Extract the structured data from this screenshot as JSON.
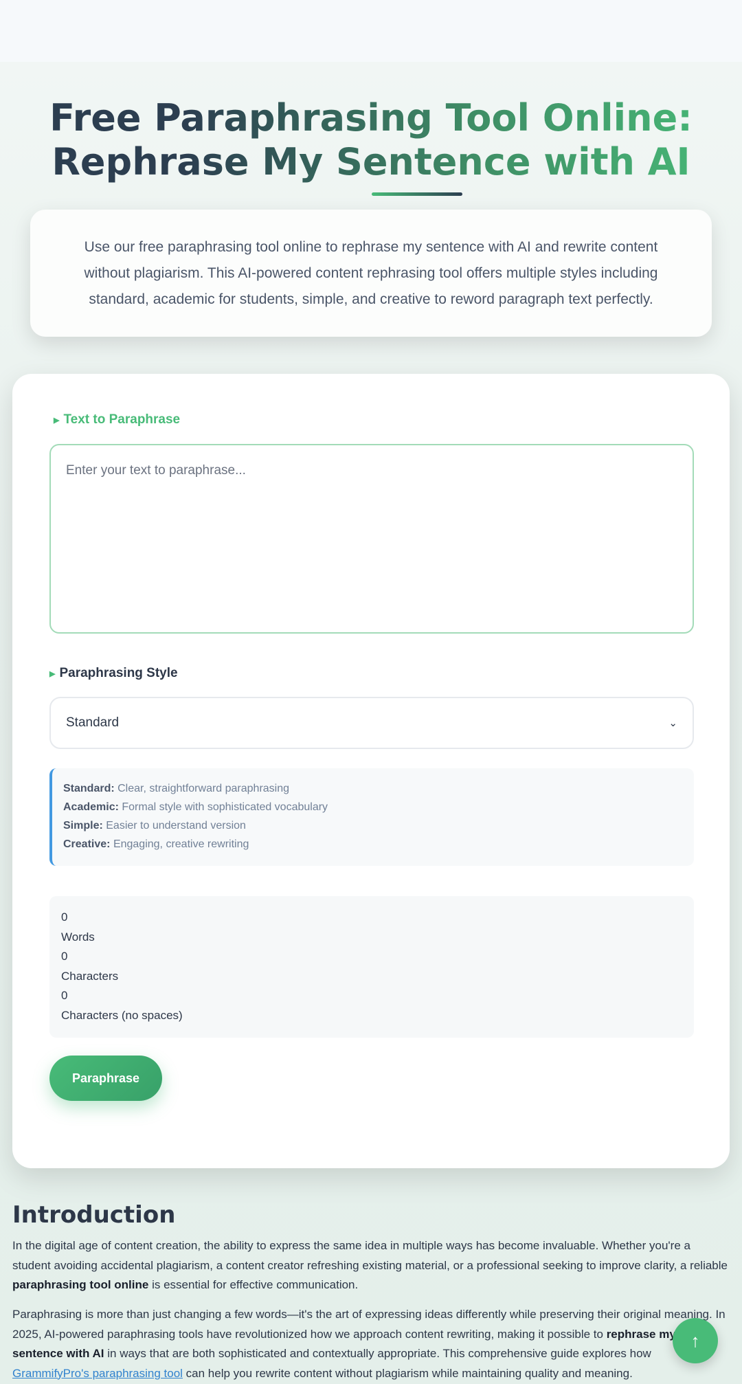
{
  "hero": {
    "title": "Free Paraphrasing Tool Online: Rephrase My Sentence with AI",
    "description": "Use our free paraphrasing tool online to rephrase my sentence with AI and rewrite content without plagiarism. This AI-powered content rephrasing tool offers multiple styles including standard, academic for students, simple, and creative to reword paragraph text perfectly."
  },
  "tool": {
    "text_label": "Text to Paraphrase",
    "textarea_placeholder": "Enter your text to paraphrase...",
    "style_label": "Paraphrasing Style",
    "style_selected": "Standard",
    "styles_info": [
      {
        "name": "Standard:",
        "desc": "Clear, straightforward paraphrasing"
      },
      {
        "name": "Academic:",
        "desc": "Formal style with sophisticated vocabulary"
      },
      {
        "name": "Simple:",
        "desc": "Easier to understand version"
      },
      {
        "name": "Creative:",
        "desc": "Engaging, creative rewriting"
      }
    ],
    "stats": {
      "words_count": "0",
      "words_label": "Words",
      "chars_count": "0",
      "chars_label": "Characters",
      "chars_nospace_count": "0",
      "chars_nospace_label": "Characters (no spaces)"
    },
    "button_label": "Paraphrase"
  },
  "introduction": {
    "heading": "Introduction",
    "p1_a": "In the digital age of content creation, the ability to express the same idea in multiple ways has become invaluable. Whether you're a student avoiding accidental plagiarism, a content creator refreshing existing material, or a professional seeking to improve clarity, a reliable ",
    "p1_b": "paraphrasing tool online",
    "p1_c": " is essential for effective communication.",
    "p2_a": "Paraphrasing is more than just changing a few words—it's the art of expressing ideas differently while preserving their original meaning. In 2025, AI-powered paraphrasing tools have revolutionized how we approach content rewriting, making it possible to ",
    "p2_b": "rephrase my sentence with AI",
    "p2_c": " in ways that are both sophisticated and contextually appropriate. This comprehensive guide explores how ",
    "p2_link": "GrammifyPro's paraphrasing tool",
    "p2_d": " can help you rewrite content without plagiarism while maintaining quality and meaning."
  },
  "scroll_top": {
    "icon": "arrow-up-icon",
    "glyph": "↑"
  },
  "colors": {
    "accent": "#48bb78",
    "info_border": "#4299e1",
    "text": "#2d3748"
  }
}
